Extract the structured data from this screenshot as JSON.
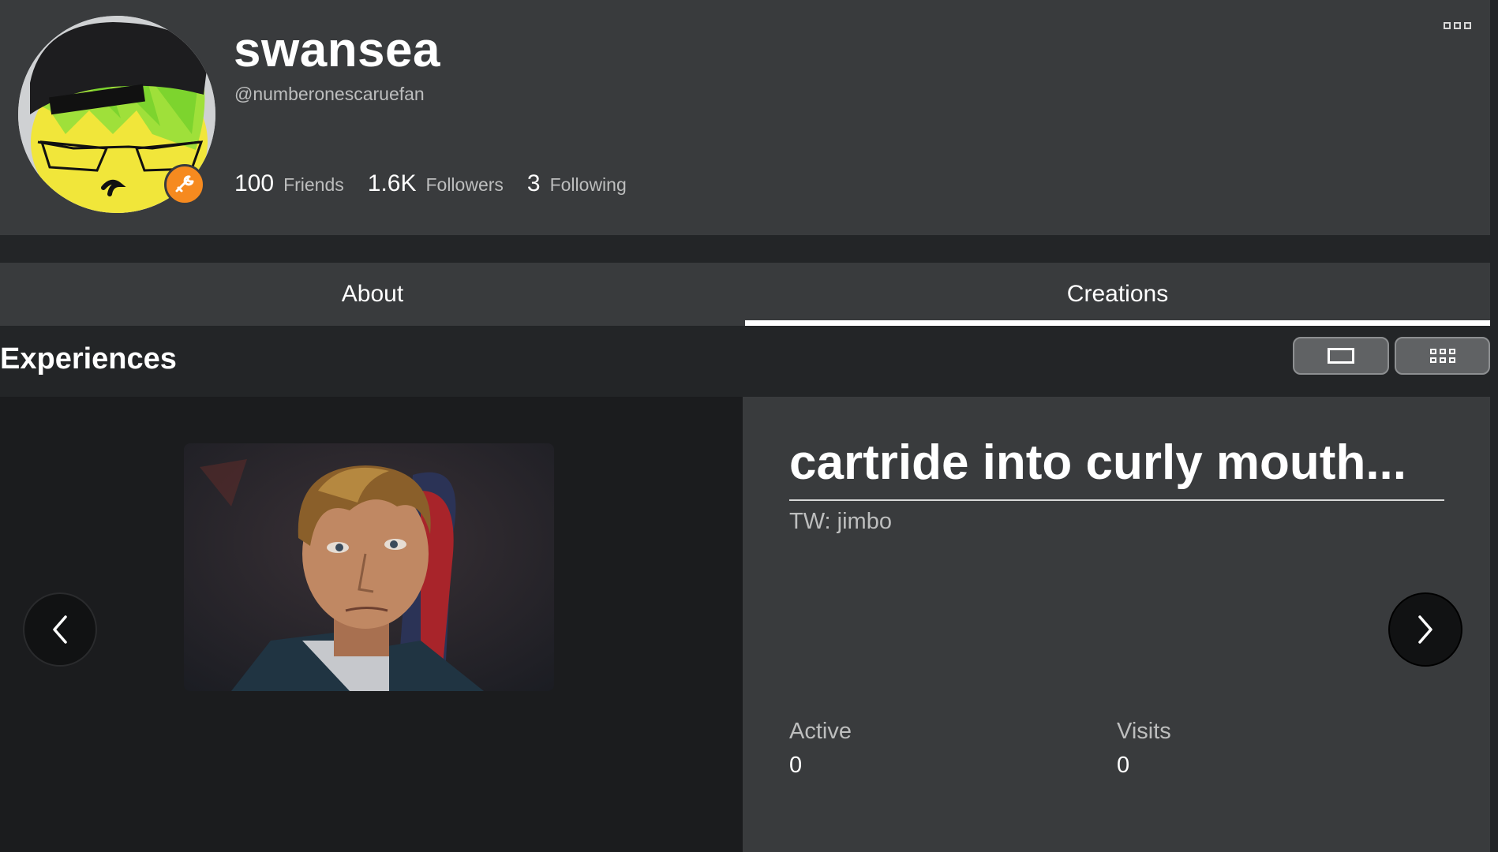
{
  "profile": {
    "display_name": "swansea",
    "username": "@numberonescaruefan",
    "stats": [
      {
        "value": "100",
        "label": "Friends"
      },
      {
        "value": "1.6K",
        "label": "Followers"
      },
      {
        "value": "3",
        "label": "Following"
      }
    ],
    "badge_icon": "wrench-icon",
    "badge_color": "#f68a1f"
  },
  "tabs": [
    {
      "label": "About",
      "active": false
    },
    {
      "label": "Creations",
      "active": true
    }
  ],
  "experiences": {
    "title": "Experiences",
    "view_modes": [
      "single-view-icon",
      "grid-view-icon"
    ],
    "current": {
      "name": "cartride into curly mouth...",
      "description": "TW: jimbo",
      "active_label": "Active",
      "active_value": "0",
      "visits_label": "Visits",
      "visits_value": "0"
    }
  }
}
